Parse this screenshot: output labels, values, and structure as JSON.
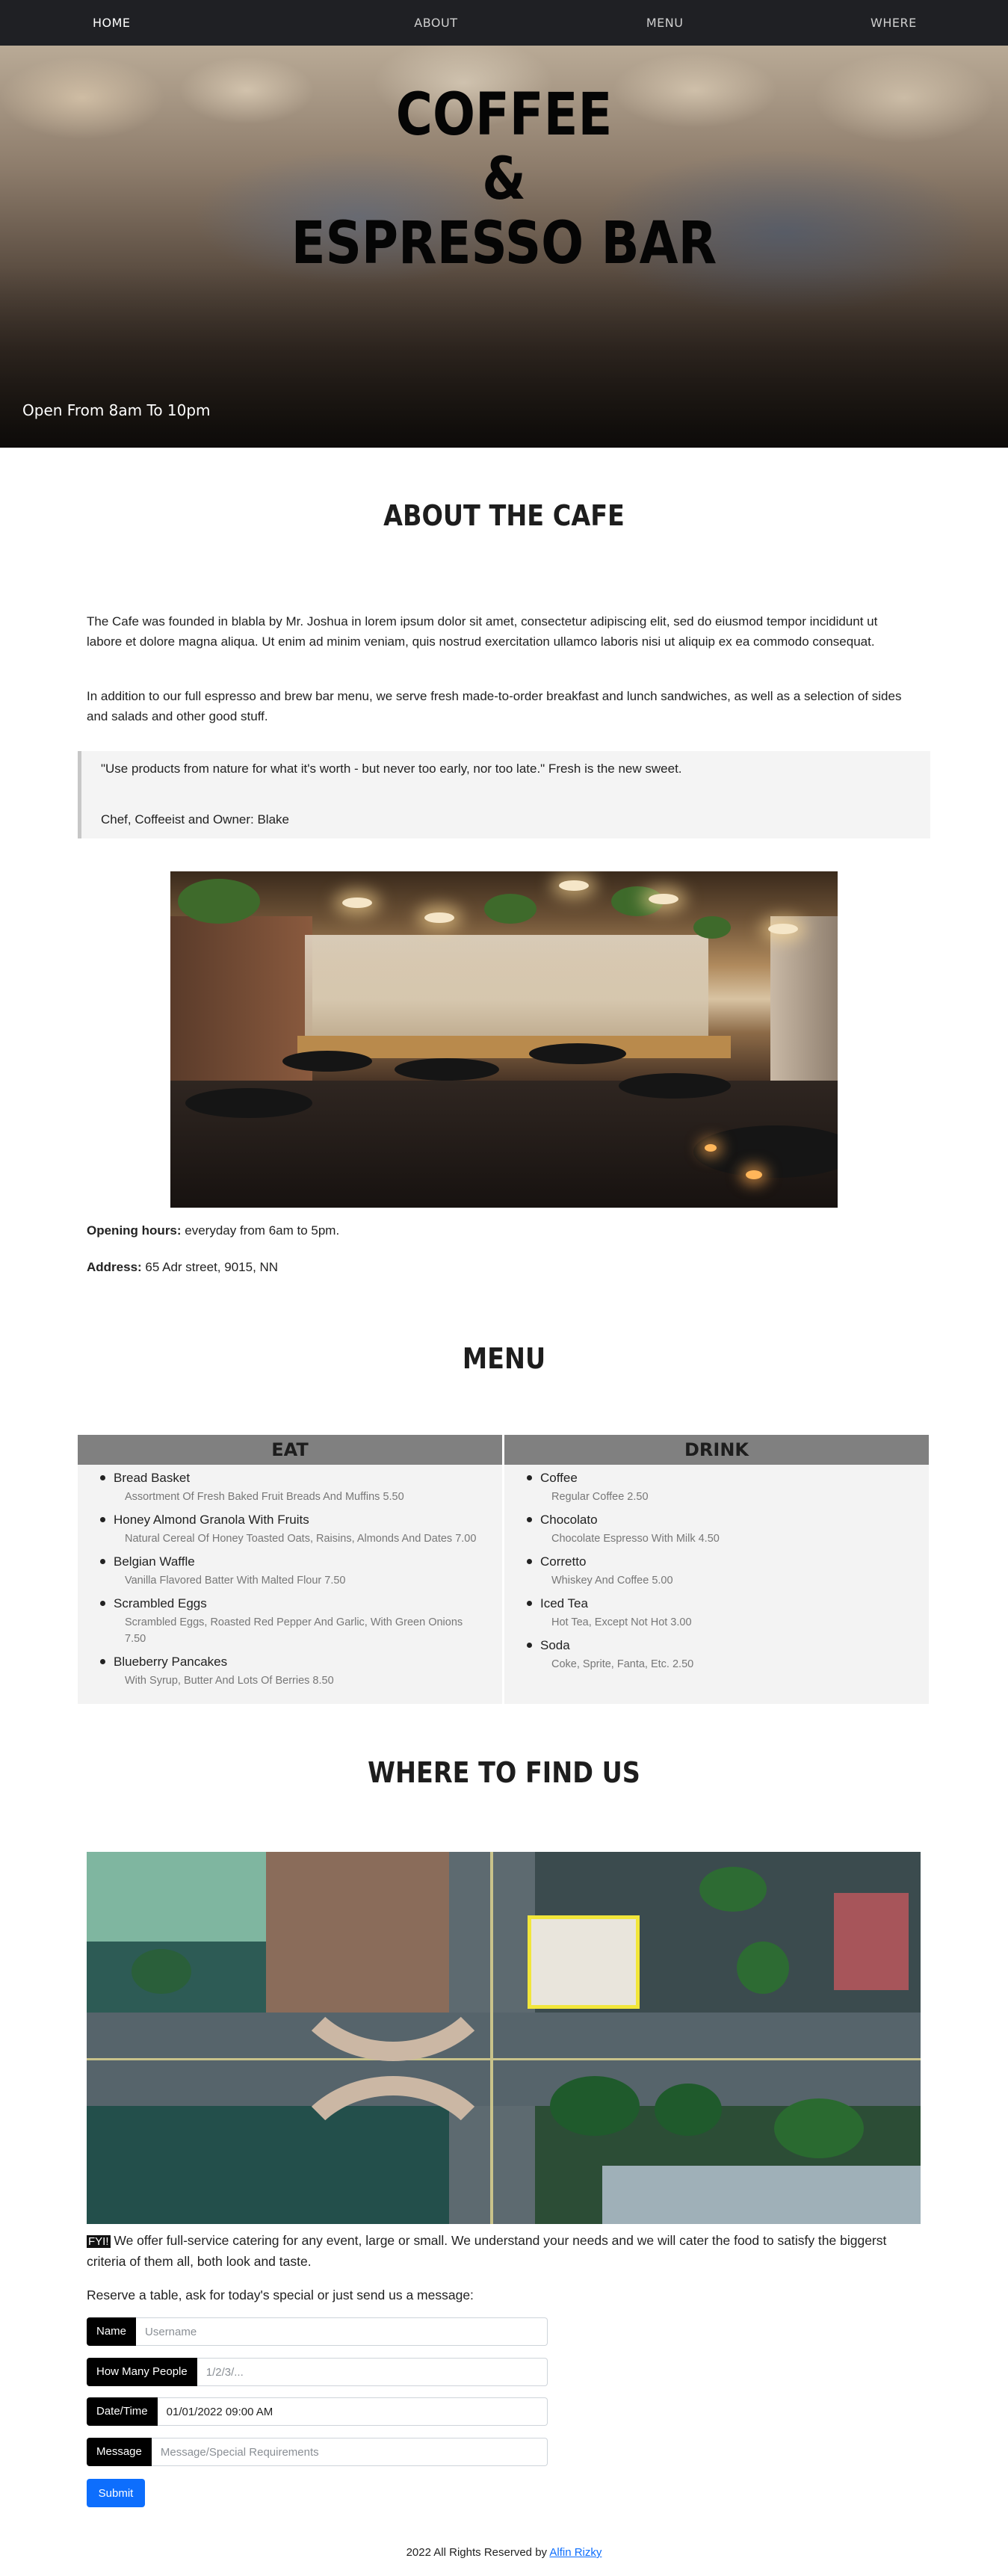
{
  "nav": {
    "items": [
      "HOME",
      "ABOUT",
      "MENU",
      "WHERE"
    ]
  },
  "hero": {
    "title_line1": "COFFEE",
    "title_line2": "&",
    "title_line3": "ESPRESSO BAR",
    "subtitle": "Open From 8am To 10pm"
  },
  "about": {
    "title": "ABOUT THE CAFE",
    "paragraph1": "The Cafe was founded in blabla by Mr. Joshua in lorem ipsum dolor sit amet, consectetur adipiscing elit, sed do eiusmod tempor incididunt ut labore et dolore magna aliqua. Ut enim ad minim veniam, quis nostrud exercitation ullamco laboris nisi ut aliquip ex ea commodo consequat.",
    "paragraph2": "In addition to our full espresso and brew bar menu, we serve fresh made-to-order breakfast and lunch sandwiches, as well as a selection of sides and salads and other good stuff.",
    "quote": "\"Use products from nature for what it's worth - but never too early, nor too late.\" Fresh is the new sweet.",
    "quote_author": "Chef, Coffeeist and Owner: Blake",
    "hours_label": "Opening hours:",
    "hours_value": " everyday from 6am to 5pm.",
    "address_label": "Address:",
    "address_value": " 65 Adr street, 9015, NN"
  },
  "menu": {
    "title": "MENU",
    "eat_title": "EAT",
    "drink_title": "DRINK",
    "eat": [
      {
        "name": "Bread Basket",
        "desc": "Assortment Of Fresh Baked Fruit Breads And Muffins 5.50"
      },
      {
        "name": "Honey Almond Granola With Fruits",
        "desc": "Natural Cereal Of Honey Toasted Oats, Raisins, Almonds And Dates 7.00"
      },
      {
        "name": "Belgian Waffle",
        "desc": "Vanilla Flavored Batter With Malted Flour 7.50"
      },
      {
        "name": "Scrambled Eggs",
        "desc": "Scrambled Eggs, Roasted Red Pepper And Garlic, With Green Onions 7.50"
      },
      {
        "name": "Blueberry Pancakes",
        "desc": "With Syrup, Butter And Lots Of Berries 8.50"
      }
    ],
    "drink": [
      {
        "name": "Coffee",
        "desc": "Regular Coffee 2.50"
      },
      {
        "name": "Chocolato",
        "desc": "Chocolate Espresso With Milk 4.50"
      },
      {
        "name": "Corretto",
        "desc": "Whiskey And Coffee 5.00"
      },
      {
        "name": "Iced Tea",
        "desc": "Hot Tea, Except Not Hot 3.00"
      },
      {
        "name": "Soda",
        "desc": "Coke, Sprite, Fanta, Etc. 2.50"
      }
    ]
  },
  "where": {
    "title": "WHERE TO FIND US",
    "fyi": "FYI!",
    "catering": " We offer full-service catering for any event, large or small. We understand your needs and we will cater the food to satisfy the biggerst criteria of them all, both look and taste.",
    "reserve": "Reserve a table, ask for today's special or just send us a message:"
  },
  "form": {
    "name_label": "Name",
    "name_placeholder": "Username",
    "people_label": "How Many People",
    "people_placeholder": "1/2/3/...",
    "datetime_label": "Date/Time",
    "datetime_value": "01/01/2022 09:00 AM",
    "message_label": "Message",
    "message_placeholder": "Message/Special Requirements",
    "submit_label": "Submit"
  },
  "footer": {
    "text": "2022 All Rights Reserved by ",
    "link": "Alfin Rizky"
  },
  "colors": {
    "nav_bg": "#1f2024",
    "menu_header": "#808080",
    "submit": "#0d6efd"
  }
}
